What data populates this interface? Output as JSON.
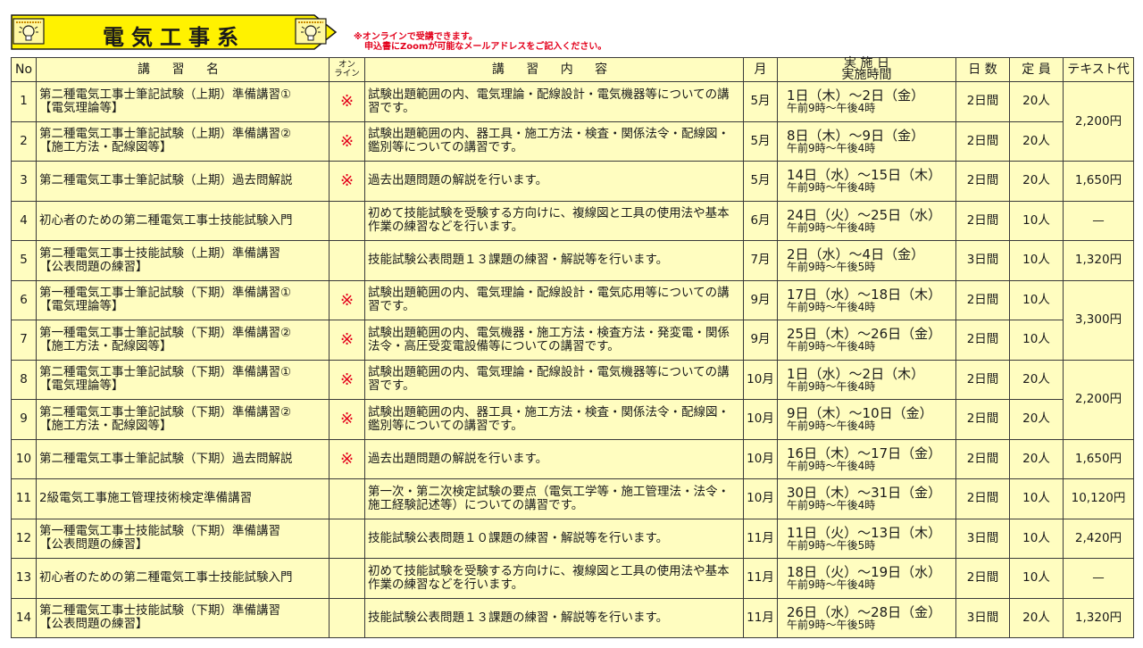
{
  "banner": {
    "title": "電気工事系",
    "icon_left": "light-bulb-icon",
    "icon_right": "light-bulb-icon",
    "fill_color": "#fff200",
    "border_color": "#1a1a1a"
  },
  "notice": {
    "line1": "※オンラインで受講できます。",
    "line2": "申込書にZoomが可能なメールアドレスをご記入ください。",
    "color": "#e3001b"
  },
  "table": {
    "headers": {
      "no": "No",
      "name": "講 習 名",
      "online_1": "オン",
      "online_2": "ライン",
      "content": "講 習 内 容",
      "month": "月",
      "date_1": "実 施 日",
      "date_2": "実施時間",
      "days": "日 数",
      "capacity": "定 員",
      "text_fee": "テキスト代"
    },
    "rows": [
      {
        "no": "1",
        "name1": "第二種電気工事士筆記試験（上期）準備講習①",
        "name2": "【電気理論等】",
        "online": "※",
        "content1": "試験出題範囲の内、電気理論・配線設計・電気機器等についての講",
        "content2": "習です。",
        "month": "5月",
        "date": "1日（木）～2日（金）",
        "time": "午前9時～午後4時",
        "days": "2日間",
        "capacity": "20人"
      },
      {
        "no": "2",
        "name1": "第二種電気工事士筆記試験（上期）準備講習②",
        "name2": "【施工方法・配線図等】",
        "online": "※",
        "content1": "試験出題範囲の内、器工具・施工方法・検査・関係法令・配線図・",
        "content2": "鑑別等についての講習です。",
        "month": "5月",
        "date": "8日（木）～9日（金）",
        "time": "午前9時～午後4時",
        "days": "2日間",
        "capacity": "20人"
      },
      {
        "no": "3",
        "name1": "第二種電気工事士筆記試験（上期）過去問解説",
        "name2": "",
        "online": "※",
        "content1": "過去出題問題の解説を行います。",
        "content2": "",
        "month": "5月",
        "date": "14日（水）～15日（木）",
        "time": "午前9時～午後4時",
        "days": "2日間",
        "capacity": "20人"
      },
      {
        "no": "4",
        "name1": "初心者のための第二種電気工事士技能試験入門",
        "name2": "",
        "online": "",
        "content1": "初めて技能試験を受験する方向けに、複線図と工具の使用法や基本",
        "content2": "作業の練習などを行います。",
        "month": "6月",
        "date": "24日（火）～25日（水）",
        "time": "午前9時～午後4時",
        "days": "2日間",
        "capacity": "10人"
      },
      {
        "no": "5",
        "name1": "第二種電気工事士技能試験（上期）準備講習",
        "name2": "【公表問題の練習】",
        "online": "",
        "content1": "技能試験公表問題１３課題の練習・解説等を行います。",
        "content2": "",
        "month": "7月",
        "date": "2日（水）～4日（金）",
        "time": "午前9時～午後5時",
        "days": "3日間",
        "capacity": "10人"
      },
      {
        "no": "6",
        "name1": "第一種電気工事士筆記試験（下期）準備講習①",
        "name2": "【電気理論等】",
        "online": "※",
        "content1": "試験出題範囲の内、電気理論・配線設計・電気応用等についての講",
        "content2": "習です。",
        "month": "9月",
        "date": "17日（水）～18日（木）",
        "time": "午前9時～午後4時",
        "days": "2日間",
        "capacity": "10人"
      },
      {
        "no": "7",
        "name1": "第一種電気工事士筆記試験（下期）準備講習②",
        "name2": "【施工方法・配線図等】",
        "online": "※",
        "content1": "試験出題範囲の内、電気機器・施工方法・検査方法・発変電・関係",
        "content2": "法令・高圧受変電設備等についての講習です。",
        "month": "9月",
        "date": "25日（木）～26日（金）",
        "time": "午前9時～午後4時",
        "days": "2日間",
        "capacity": "10人"
      },
      {
        "no": "8",
        "name1": "第二種電気工事士筆記試験（下期）準備講習①",
        "name2": "【電気理論等】",
        "online": "※",
        "content1": "試験出題範囲の内、電気理論・配線設計・電気機器等についての講",
        "content2": "習です。",
        "month": "10月",
        "date": "1日（水）～2日（木）",
        "time": "午前9時～午後4時",
        "days": "2日間",
        "capacity": "20人"
      },
      {
        "no": "9",
        "name1": "第二種電気工事士筆記試験（下期）準備講習②",
        "name2": "【施工方法・配線図等】",
        "online": "※",
        "content1": "試験出題範囲の内、器工具・施工方法・検査・関係法令・配線図・",
        "content2": "鑑別等についての講習です。",
        "month": "10月",
        "date": "9日（木）～10日（金）",
        "time": "午前9時～午後4時",
        "days": "2日間",
        "capacity": "20人"
      },
      {
        "no": "10",
        "name1": "第二種電気工事士筆記試験（下期）過去問解説",
        "name2": "",
        "online": "※",
        "content1": "過去出題問題の解説を行います。",
        "content2": "",
        "month": "10月",
        "date": "16日（木）～17日（金）",
        "time": "午前9時～午後4時",
        "days": "2日間",
        "capacity": "20人"
      },
      {
        "no": "11",
        "name1": "2級電気工事施工管理技術検定準備講習",
        "name2": "",
        "online": "",
        "content1": "第一次・第二次検定試験の要点（電気工学等・施工管理法・法令・",
        "content2": "施工経験記述等）についての講習です。",
        "month": "10月",
        "date": "30日（木）～31日（金）",
        "time": "午前9時～午後4時",
        "days": "2日間",
        "capacity": "10人"
      },
      {
        "no": "12",
        "name1": "第一種電気工事士技能試験（下期）準備講習",
        "name2": "【公表問題の練習】",
        "online": "",
        "content1": "技能試験公表問題１０課題の練習・解説等を行います。",
        "content2": "",
        "month": "11月",
        "date": "11日（火）～13日（木）",
        "time": "午前9時～午後5時",
        "days": "3日間",
        "capacity": "10人"
      },
      {
        "no": "13",
        "name1": "初心者のための第二種電気工事士技能試験入門",
        "name2": "",
        "online": "",
        "content1": "初めて技能試験を受験する方向けに、複線図と工具の使用法や基本",
        "content2": "作業の練習などを行います。",
        "month": "11月",
        "date": "18日（火）～19日（水）",
        "time": "午前9時～午後4時",
        "days": "2日間",
        "capacity": "10人"
      },
      {
        "no": "14",
        "name1": "第二種電気工事士技能試験（下期）準備講習",
        "name2": "【公表問題の練習】",
        "online": "",
        "content1": "技能試験公表問題１３課題の練習・解説等を行います。",
        "content2": "",
        "month": "11月",
        "date": "26日（水）～28日（金）",
        "time": "午前9時～午後5時",
        "days": "3日間",
        "capacity": "20人"
      }
    ],
    "text_fees": [
      {
        "row_index": 0,
        "rowspan": 2,
        "value": "2,200円"
      },
      {
        "row_index": 2,
        "rowspan": 1,
        "value": "1,650円"
      },
      {
        "row_index": 3,
        "rowspan": 1,
        "value": "—"
      },
      {
        "row_index": 4,
        "rowspan": 1,
        "value": "1,320円"
      },
      {
        "row_index": 5,
        "rowspan": 2,
        "value": "3,300円"
      },
      {
        "row_index": 7,
        "rowspan": 2,
        "value": "2,200円"
      },
      {
        "row_index": 9,
        "rowspan": 1,
        "value": "1,650円"
      },
      {
        "row_index": 10,
        "rowspan": 1,
        "value": "10,120円"
      },
      {
        "row_index": 11,
        "rowspan": 1,
        "value": "2,420円"
      },
      {
        "row_index": 12,
        "rowspan": 1,
        "value": "—"
      },
      {
        "row_index": 13,
        "rowspan": 1,
        "value": "1,320円"
      }
    ],
    "background_color": "#fffdc0",
    "online_mark_color": "#e3001b"
  }
}
